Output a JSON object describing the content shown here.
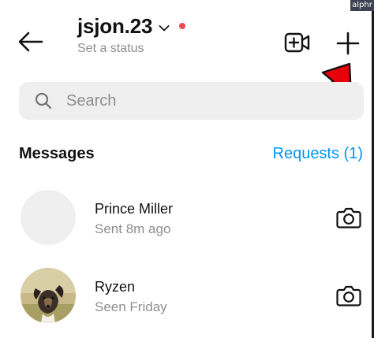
{
  "header": {
    "username": "jsjon.23",
    "status_placeholder": "Set a status"
  },
  "watermark": "alphr",
  "search": {
    "placeholder": "Search"
  },
  "messages": {
    "title": "Messages",
    "requests_label": "Requests (1)"
  },
  "conversations": [
    {
      "name": "Prince Miller",
      "subtitle": "Sent 8m ago"
    },
    {
      "name": "Ryzen",
      "subtitle": "Seen Friday"
    }
  ],
  "colors": {
    "accent_blue": "#0095f6",
    "status_dot": "#ed4956",
    "annotation_arrow": "#e8000b"
  },
  "icons": {
    "back": "arrow-left-icon",
    "chevron": "chevron-down-icon",
    "video": "video-plus-icon",
    "plus": "plus-icon",
    "search": "search-icon",
    "camera": "camera-icon"
  }
}
